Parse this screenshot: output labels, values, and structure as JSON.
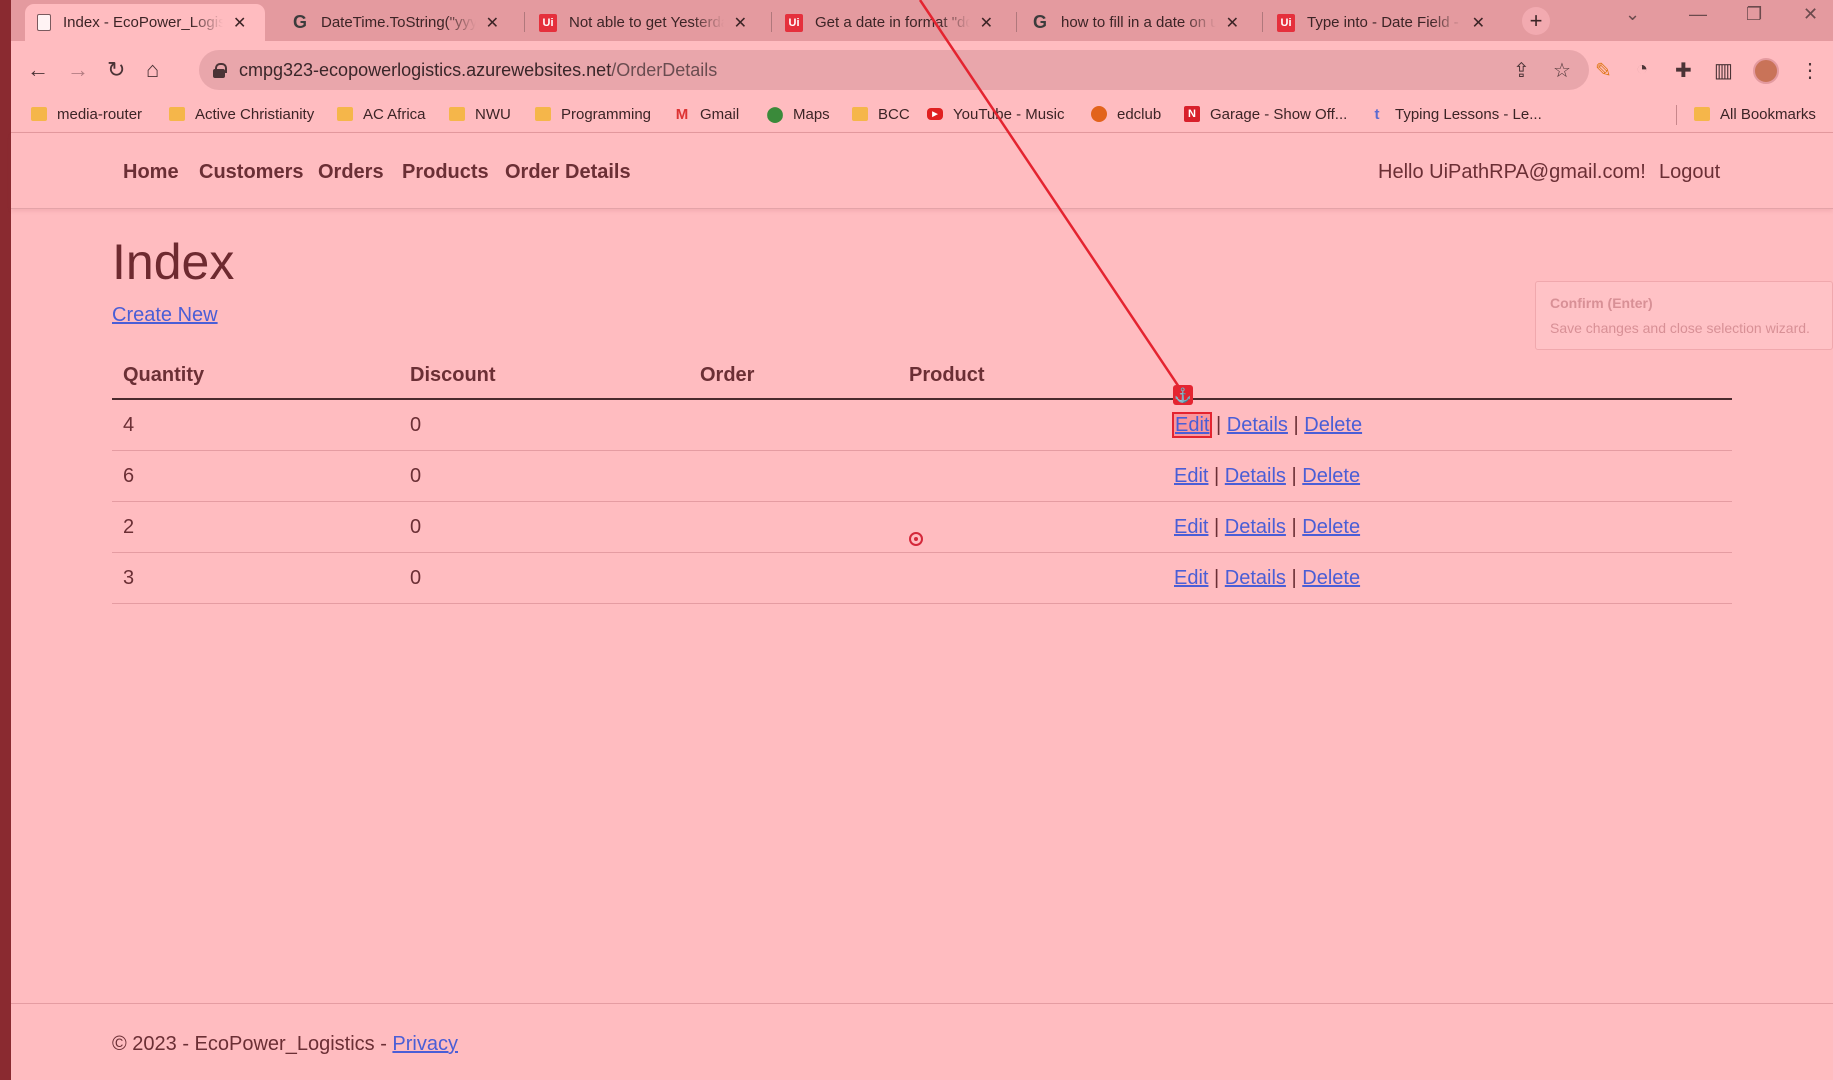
{
  "browser": {
    "tabs": [
      {
        "title": "Index - EcoPower_Logistics",
        "icon": "document-icon",
        "active": true
      },
      {
        "title": "DateTime.ToString(\"yyyy",
        "icon": "google-icon"
      },
      {
        "title": "Not able to get Yesterday",
        "icon": "uipath-icon"
      },
      {
        "title": "Get a date in format \"dd",
        "icon": "uipath-icon"
      },
      {
        "title": "how to fill in a date on u",
        "icon": "google-icon"
      },
      {
        "title": "Type into - Date Field - U",
        "icon": "uipath-icon"
      }
    ],
    "url_host": "cmpg323-ecopowerlogistics.azurewebsites.net",
    "url_path": "/OrderDetails",
    "bookmarks": [
      {
        "label": "media-router",
        "icon": "folder-icon"
      },
      {
        "label": "Active Christianity",
        "icon": "folder-icon"
      },
      {
        "label": "AC Africa",
        "icon": "folder-icon"
      },
      {
        "label": "NWU",
        "icon": "folder-icon"
      },
      {
        "label": "Programming",
        "icon": "folder-icon"
      },
      {
        "label": "Gmail",
        "icon": "gmail-icon"
      },
      {
        "label": "Maps",
        "icon": "maps-icon"
      },
      {
        "label": "BCC",
        "icon": "folder-icon"
      },
      {
        "label": "YouTube - Music",
        "icon": "youtube-icon"
      },
      {
        "label": "edclub",
        "icon": "edclub-icon"
      },
      {
        "label": "Garage - Show Off...",
        "icon": "garage-icon"
      },
      {
        "label": "Typing Lessons - Le...",
        "icon": "typing-icon"
      }
    ],
    "all_bookmarks": "All Bookmarks"
  },
  "site": {
    "nav": [
      "Home",
      "Customers",
      "Orders",
      "Products",
      "Order Details"
    ],
    "hello": "Hello UiPathRPA@gmail.com!",
    "logout": "Logout"
  },
  "main": {
    "title": "Index",
    "create_new": "Create New",
    "columns": [
      "Quantity",
      "Discount",
      "Order",
      "Product"
    ],
    "rows": [
      {
        "quantity": "4",
        "discount": "0",
        "order": "",
        "product": ""
      },
      {
        "quantity": "6",
        "discount": "0",
        "order": "",
        "product": ""
      },
      {
        "quantity": "2",
        "discount": "0",
        "order": "",
        "product": ""
      },
      {
        "quantity": "3",
        "discount": "0",
        "order": "",
        "product": ""
      }
    ],
    "actions": {
      "edit": "Edit",
      "details": "Details",
      "delete": "Delete",
      "sep": "|"
    }
  },
  "overlay": {
    "confirm_title": "Confirm (Enter)",
    "confirm_desc": "Save changes and close selection wizard.",
    "anchor_icon": "anchor-icon",
    "target_icon": "target-icon",
    "accent": "#e42430"
  },
  "footer": {
    "text": "© 2023 - EcoPower_Logistics - ",
    "privacy": "Privacy"
  }
}
